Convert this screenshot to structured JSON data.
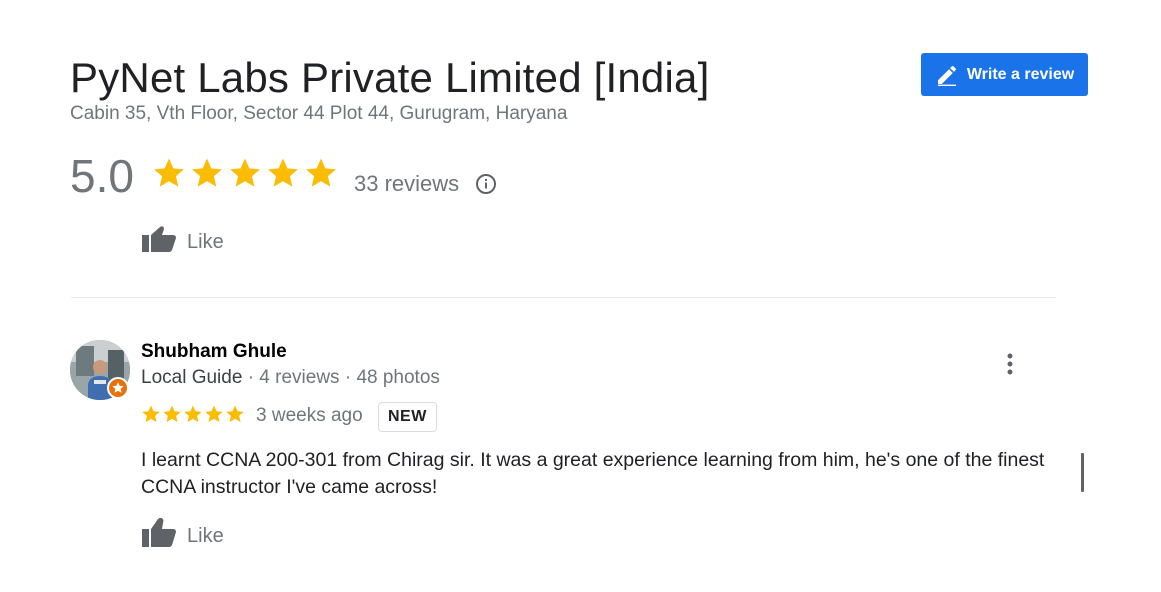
{
  "business": {
    "name": "PyNet Labs Private Limited [India]",
    "address": "Cabin 35, Vth Floor, Sector 44 Plot 44, Gurugram, Haryana"
  },
  "write_review": {
    "label": "Write a review",
    "icon": "pencil-icon"
  },
  "rating": {
    "score": "5.0",
    "stars": 5,
    "review_count_text": "33 reviews",
    "info_icon": "info-icon"
  },
  "like_top": {
    "label": "Like",
    "icon": "thumbs-up-icon"
  },
  "review": {
    "reviewer_name": "Shubham Ghule",
    "guide_label": "Local Guide",
    "separator": "·",
    "reviews_text": "4 reviews",
    "photos_text": "48 photos",
    "stars": 5,
    "date": "3 weeks ago",
    "badge": "NEW",
    "text": "I learnt CCNA 200-301 from Chirag sir. It was a great experience learning from him, he's one of the finest CCNA instructor I've came across!",
    "like_label": "Like"
  },
  "colors": {
    "accent_blue": "#1a73e8",
    "star_yellow": "#fbbc04",
    "local_guide_orange": "#e8710a",
    "muted_text": "#70757a"
  }
}
